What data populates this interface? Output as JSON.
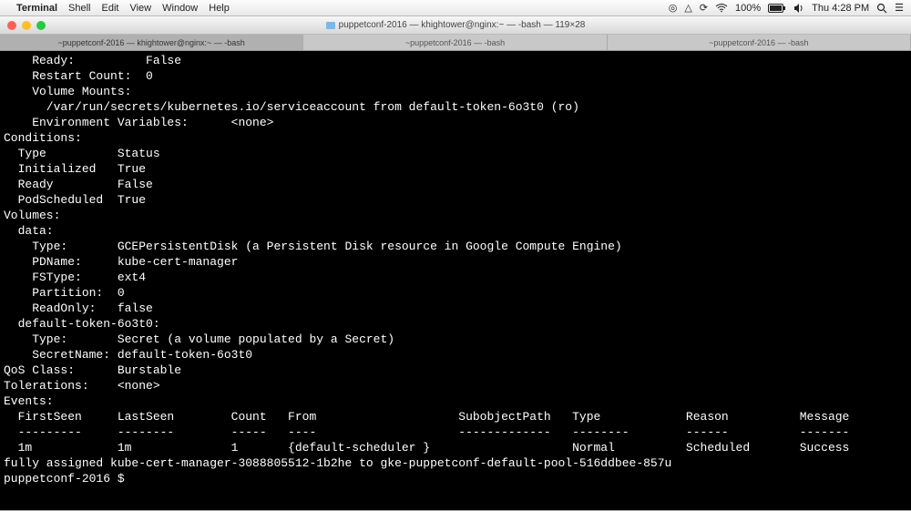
{
  "menubar": {
    "app": "Terminal",
    "items": [
      "Shell",
      "Edit",
      "View",
      "Window",
      "Help"
    ],
    "battery": "100%",
    "time": "Thu 4:28 PM"
  },
  "window": {
    "title": "puppetconf-2016 — khightower@nginx:~ — -bash — 119×28"
  },
  "tabs": [
    {
      "label": "~puppetconf-2016 — khightower@nginx:~ — -bash",
      "active": true
    },
    {
      "label": "~puppetconf-2016 — -bash",
      "active": false
    },
    {
      "label": "~puppetconf-2016 — -bash",
      "active": false
    }
  ],
  "terminal_lines": [
    "    Ready:          False",
    "    Restart Count:  0",
    "    Volume Mounts:",
    "      /var/run/secrets/kubernetes.io/serviceaccount from default-token-6o3t0 (ro)",
    "    Environment Variables:      <none>",
    "Conditions:",
    "  Type          Status",
    "  Initialized   True",
    "  Ready         False",
    "  PodScheduled  True",
    "Volumes:",
    "  data:",
    "    Type:       GCEPersistentDisk (a Persistent Disk resource in Google Compute Engine)",
    "    PDName:     kube-cert-manager",
    "    FSType:     ext4",
    "    Partition:  0",
    "    ReadOnly:   false",
    "  default-token-6o3t0:",
    "    Type:       Secret (a volume populated by a Secret)",
    "    SecretName: default-token-6o3t0",
    "QoS Class:      Burstable",
    "Tolerations:    <none>",
    "Events:",
    "  FirstSeen     LastSeen        Count   From                    SubobjectPath   Type            Reason          Message",
    "  ---------     --------        -----   ----                    -------------   --------        ------          -------",
    "  1m            1m              1       {default-scheduler }                    Normal          Scheduled       Success",
    "fully assigned kube-cert-manager-3088805512-1b2he to gke-puppetconf-default-pool-516ddbee-857u",
    "puppetconf-2016 $ "
  ]
}
